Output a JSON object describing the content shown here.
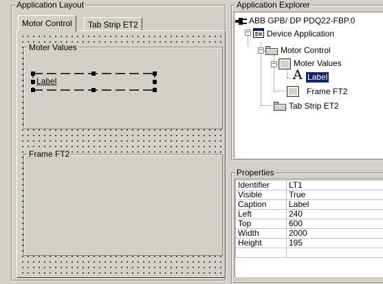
{
  "layout_panel": {
    "title": "Application Layout",
    "tabs": [
      {
        "label": "Motor Control",
        "active": true
      },
      {
        "label": "Tab Strip ET2",
        "active": false
      }
    ],
    "frames": [
      {
        "title": "Moter Values",
        "label_widget": "Label"
      },
      {
        "title": "Frame FT2"
      }
    ]
  },
  "explorer_panel": {
    "title": "Application Explorer",
    "tree": {
      "root": "ABB GPB/ DP PDQ22-FBP.0",
      "device": "Device Application",
      "motor_control": "Motor Control",
      "moter_values": "Moter Values",
      "label": "Label",
      "frame_ft2": "Frame FT2",
      "tab_strip": "Tab Strip ET2"
    }
  },
  "properties_panel": {
    "title": "Properties",
    "rows": [
      {
        "key": "Identifier",
        "value": "LT1"
      },
      {
        "key": "Visible",
        "value": "True"
      },
      {
        "key": "Caption",
        "value": "Label"
      },
      {
        "key": "Left",
        "value": "240"
      },
      {
        "key": "Top",
        "value": "600"
      },
      {
        "key": "Width",
        "value": "2000"
      },
      {
        "key": "Height",
        "value": "195"
      }
    ]
  },
  "colors": {
    "window_bg": "#d4d0c8",
    "selection": "#0a246a"
  }
}
